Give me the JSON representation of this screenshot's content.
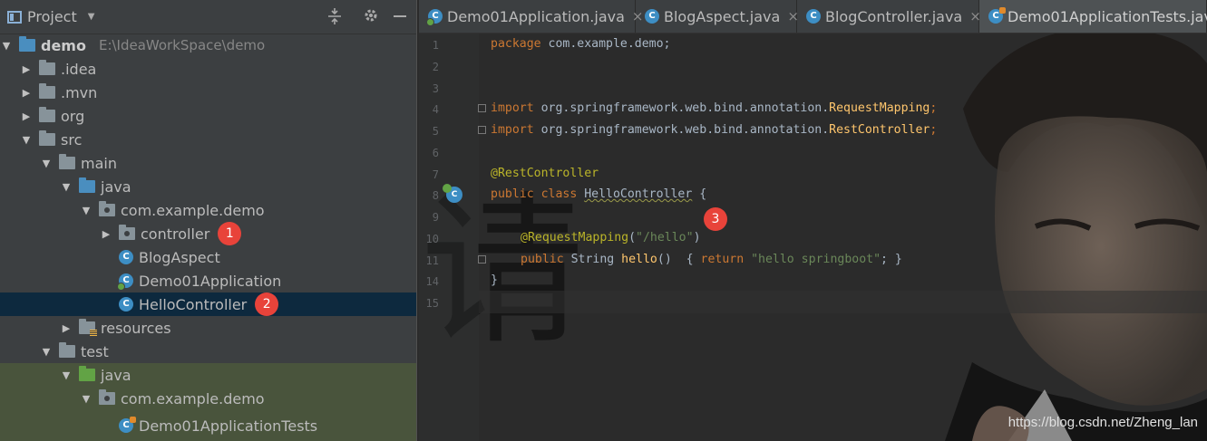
{
  "panel": {
    "title": "Project",
    "dropdown_icon": "chevron-down-icon",
    "actions": [
      "collapse-all-icon",
      "gear-icon",
      "hide-icon"
    ]
  },
  "tree": [
    {
      "label": "demo",
      "path": "E:\\IdeaWorkSpace\\demo",
      "icon": "module-folder-icon",
      "expanded": true
    },
    {
      "label": ".idea",
      "icon": "folder-icon",
      "expanded": false
    },
    {
      "label": ".mvn",
      "icon": "folder-icon",
      "expanded": false
    },
    {
      "label": "org",
      "icon": "folder-icon",
      "expanded": false
    },
    {
      "label": "src",
      "icon": "folder-icon",
      "expanded": true
    },
    {
      "label": "main",
      "icon": "folder-icon",
      "expanded": true
    },
    {
      "label": "java",
      "icon": "source-folder-icon",
      "expanded": true
    },
    {
      "label": "com.example.demo",
      "icon": "package-icon",
      "expanded": true
    },
    {
      "label": "controller",
      "icon": "package-icon",
      "expanded": false,
      "badge": "1"
    },
    {
      "label": "BlogAspect",
      "icon": "class-icon"
    },
    {
      "label": "Demo01Application",
      "icon": "spring-boot-class-icon"
    },
    {
      "label": "HelloController",
      "icon": "class-icon",
      "selected": true,
      "badge": "2"
    },
    {
      "label": "resources",
      "icon": "resources-folder-icon",
      "expanded": false
    },
    {
      "label": "test",
      "icon": "folder-icon",
      "expanded": true
    },
    {
      "label": "java",
      "icon": "test-source-folder-icon",
      "expanded": true
    },
    {
      "label": "com.example.demo",
      "icon": "package-icon",
      "expanded": true
    },
    {
      "label": "Demo01ApplicationTests",
      "icon": "test-class-icon"
    }
  ],
  "tabs": [
    {
      "label": "Demo01Application.java",
      "close": "×"
    },
    {
      "label": "BlogAspect.java",
      "close": "×"
    },
    {
      "label": "BlogController.java",
      "close": "×"
    },
    {
      "label": "Demo01ApplicationTests.java",
      "active": true
    }
  ],
  "editor": {
    "line_numbers": [
      "1",
      "2",
      "3",
      "4",
      "5",
      "6",
      "7",
      "8",
      "9",
      "10",
      "11",
      "14",
      "15"
    ],
    "code": {
      "l1_kw": "package",
      "l1_rest": " com.example.demo;",
      "l4_kw": "import",
      "l4_pkg": " org.springframework.web.bind.annotation.",
      "l4_cls": "RequestMapping",
      "l4_end": ";",
      "l5_kw": "import",
      "l5_pkg": " org.springframework.web.bind.annotation.",
      "l5_cls": "RestController",
      "l5_end": ";",
      "l7_ann": "@RestController",
      "l8_kw1": "public",
      "l8_kw2": " class ",
      "l8_name": "HelloController",
      "l8_end": " {",
      "l10_ann": "@RequestMapping",
      "l10_p1": "(",
      "l10_str": "\"/hello\"",
      "l10_p2": ")",
      "l11_kw": "public",
      "l11_ty": " String ",
      "l11_fn": "hello",
      "l11_p": "()  { ",
      "l11_ret": "return",
      "l11_sp": " ",
      "l11_str": "\"hello springboot\"",
      "l11_end": "; }",
      "l14": "}"
    },
    "badge": "3",
    "gutter_icon": "spring-bean-icon",
    "background_glyph": "请"
  },
  "watermark": "https://blog.csdn.net/Zheng_lan",
  "colors": {
    "keyword": "#cc7832",
    "annotation": "#bbb529",
    "string": "#6a8759",
    "method": "#ffc66d",
    "badge": "#e8433a",
    "selection": "#0d293e"
  }
}
